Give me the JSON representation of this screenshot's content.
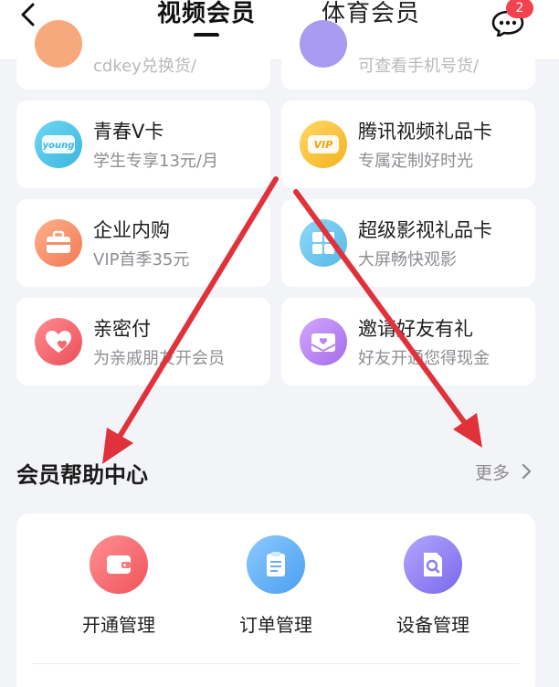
{
  "header": {
    "tabs": [
      {
        "label": "视频会员",
        "active": true
      },
      {
        "label": "体育会员",
        "active": false
      }
    ],
    "message_badge": "2"
  },
  "top_partial": {
    "left_sub": "cdkey兑换货/",
    "right_sub": "可查看手机号货/"
  },
  "cards": [
    {
      "title": "青春V卡",
      "subtitle": "学生专享13元/月",
      "icon": "young-icon",
      "icon_text": "young"
    },
    {
      "title": "腾讯视频礼品卡",
      "subtitle": "专属定制好时光",
      "icon": "vip-icon",
      "icon_text": "VIP"
    },
    {
      "title": "企业内购",
      "subtitle": "VIP首季35元",
      "icon": "briefcase-icon"
    },
    {
      "title": "超级影视礼品卡",
      "subtitle": "大屏畅快观影",
      "icon": "gift-grid-icon"
    },
    {
      "title": "亲密付",
      "subtitle": "为亲戚朋友开会员",
      "icon": "heart-icon"
    },
    {
      "title": "邀请好友有礼",
      "subtitle": "好友开通您得现金",
      "icon": "envelope-heart-icon"
    }
  ],
  "help_center": {
    "title": "会员帮助中心",
    "more_label": "更多",
    "items": [
      {
        "label": "开通管理",
        "icon": "wallet-icon"
      },
      {
        "label": "订单管理",
        "icon": "clipboard-icon"
      },
      {
        "label": "设备管理",
        "icon": "device-search-icon"
      }
    ]
  },
  "colors": {
    "background": "#f3f4f8",
    "badge": "#f2424d",
    "arrow": "#e0323a",
    "young": "#4bc4e6",
    "vip": "#f6c13a",
    "briefcase": "#f48a5e",
    "gift": "#6ec8ee",
    "heart": "#f0616a",
    "envelope": "#b27df0",
    "wallet": "#f46a6e",
    "clipboard": "#5aaef0",
    "device": "#8a7cf0"
  }
}
